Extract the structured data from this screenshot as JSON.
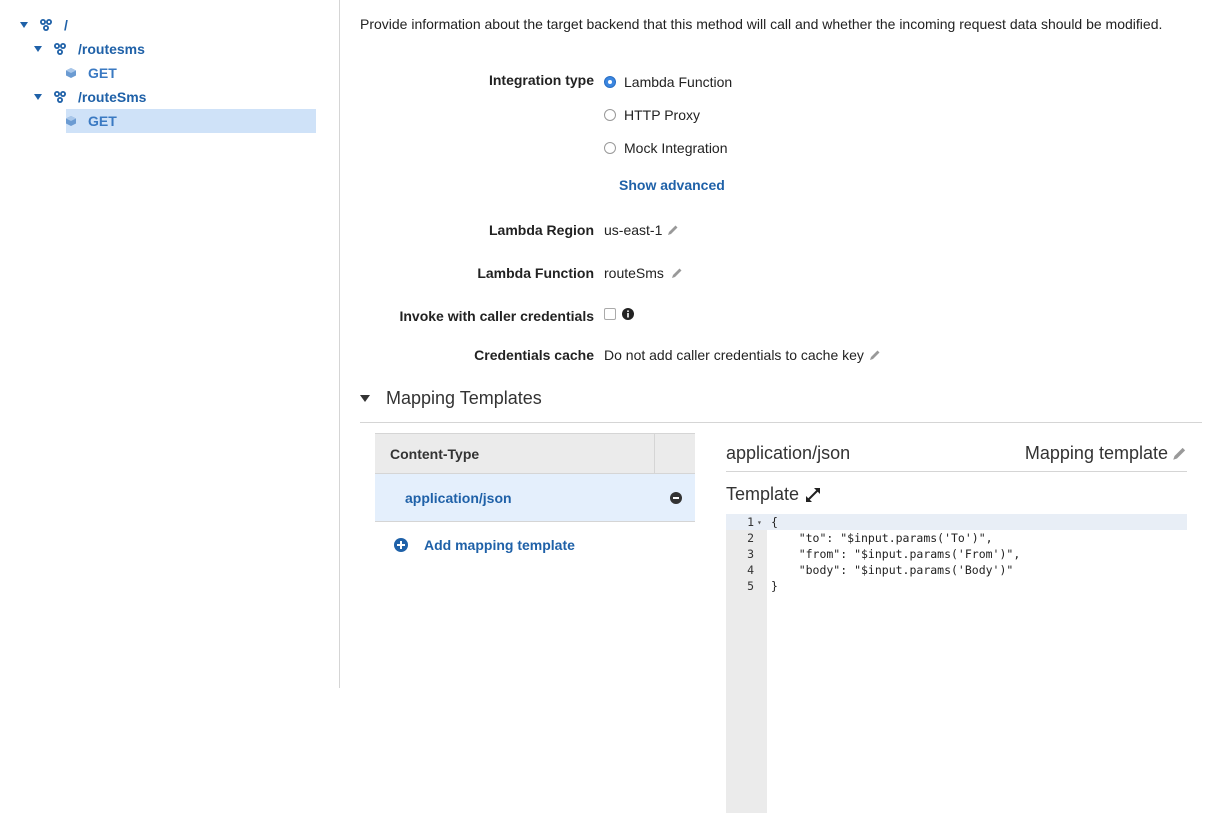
{
  "tree": {
    "root": "/",
    "routesms": "/routesms",
    "routesms_get": "GET",
    "routeSms": "/routeSms",
    "routeSms_get": "GET"
  },
  "intro": "Provide information about the target backend that this method will call and whether the incoming request data should be modified.",
  "integration": {
    "label": "Integration type",
    "options": [
      "Lambda Function",
      "HTTP Proxy",
      "Mock Integration"
    ],
    "selected": "Lambda Function",
    "show_advanced": "Show advanced"
  },
  "lambda_region": {
    "label": "Lambda Region",
    "value": "us-east-1"
  },
  "lambda_function": {
    "label": "Lambda Function",
    "value": "routeSms"
  },
  "invoke_caller": {
    "label": "Invoke with caller credentials"
  },
  "credentials_cache": {
    "label": "Credentials cache",
    "value": "Do not add caller credentials to cache key"
  },
  "mapping": {
    "section_title": "Mapping Templates",
    "content_type_header": "Content-Type",
    "content_types": [
      "application/json"
    ],
    "add_label": "Add mapping template",
    "selected_type": "application/json",
    "mapping_template_label": "Mapping template",
    "template_title": "Template",
    "template_lines": [
      "{",
      "    \"to\": \"$input.params('To')\",",
      "    \"from\": \"$input.params('From')\",",
      "    \"body\": \"$input.params('Body')\"",
      "}"
    ],
    "line_numbers": [
      "1",
      "2",
      "3",
      "4",
      "5"
    ]
  },
  "colors": {
    "link": "#1f61a8",
    "selected_row": "#cfe2f8",
    "radio_checked": "#3b86e0"
  }
}
